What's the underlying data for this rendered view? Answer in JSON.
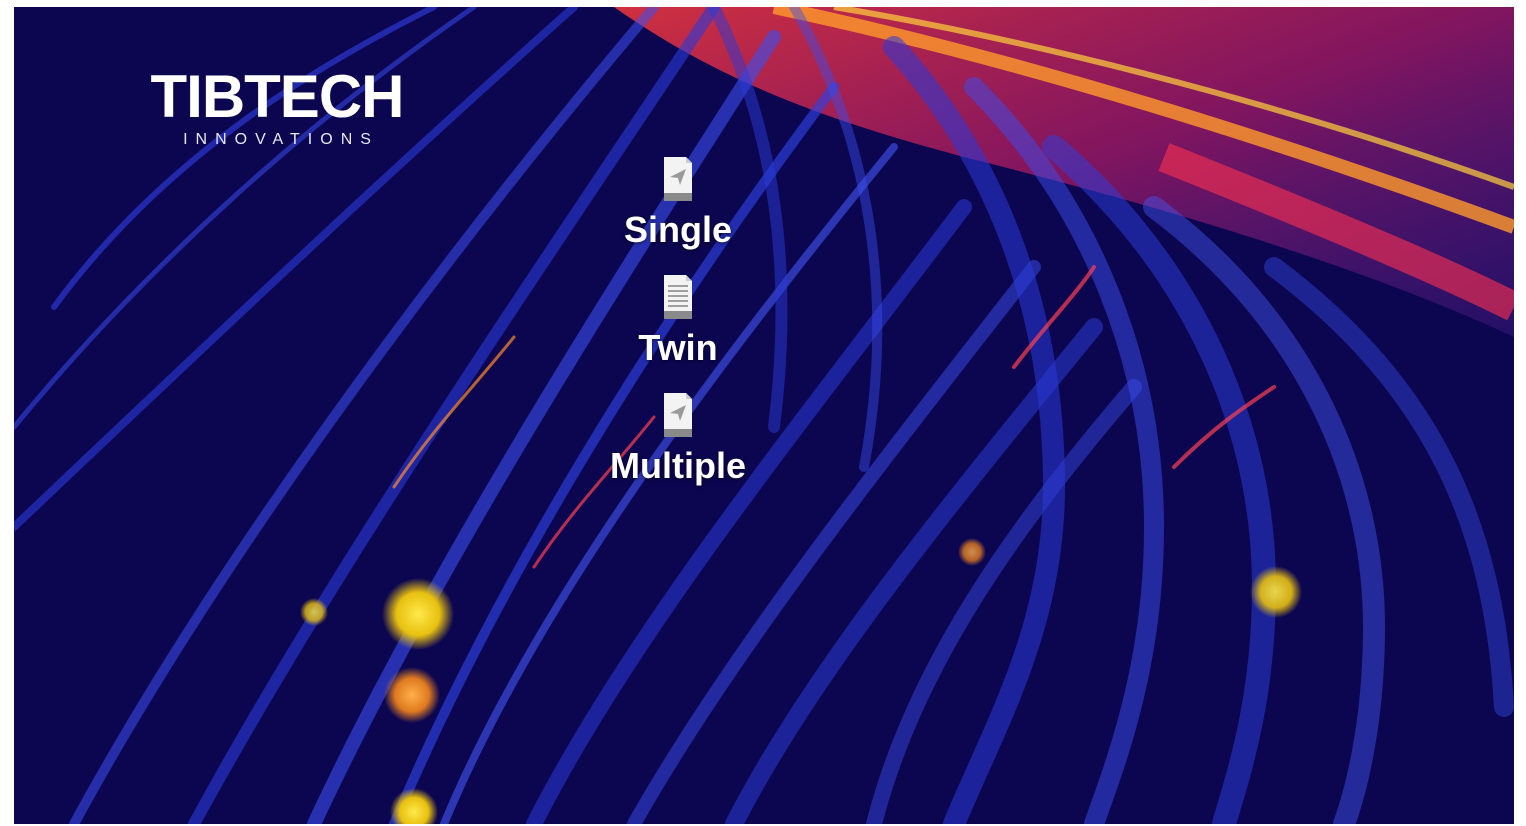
{
  "brand": {
    "title": "TIBTECH",
    "subtitle": "INNOVATIONS"
  },
  "menu": {
    "items": [
      {
        "label": "Single",
        "icon": "send-document-icon"
      },
      {
        "label": "Twin",
        "icon": "text-document-icon"
      },
      {
        "label": "Multiple",
        "icon": "send-document-icon"
      }
    ]
  },
  "colors": {
    "background": "#0c0650",
    "streak_blue": "#2a3ad8",
    "streak_red": "#e8204a",
    "glow_yellow": "#f2d21a",
    "text": "#ffffff"
  }
}
